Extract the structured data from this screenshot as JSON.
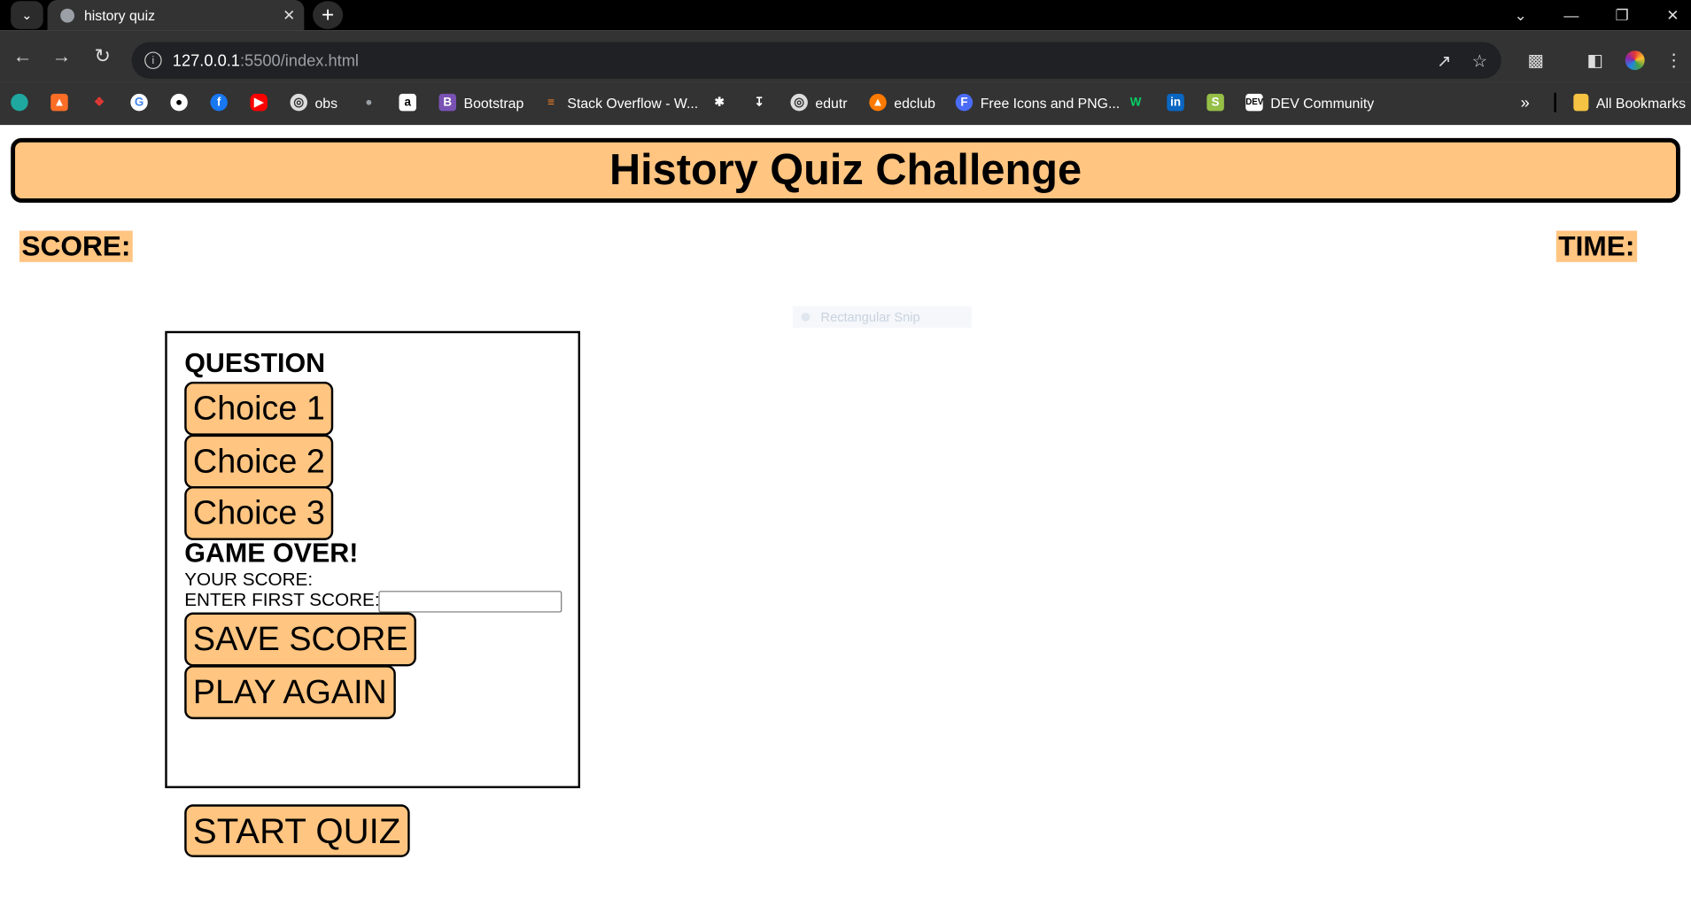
{
  "browser": {
    "tab_title": "history quiz",
    "url_host": "127.0.0.1",
    "url_path": ":5500/index.html",
    "bookmarks": [
      {
        "icon": "edge-icon",
        "label": "",
        "color": "#1fa8a0"
      },
      {
        "icon": "gitlab-icon",
        "label": "",
        "color": "#fc6d26"
      },
      {
        "icon": "codepen-icon",
        "label": "",
        "color": "#e53935"
      },
      {
        "icon": "google-icon",
        "label": "",
        "color": "#ffffff"
      },
      {
        "icon": "github-icon",
        "label": "",
        "color": "#ffffff"
      },
      {
        "icon": "facebook-icon",
        "label": "",
        "color": "#1877f2"
      },
      {
        "icon": "youtube-icon",
        "label": "",
        "color": "#ff0000"
      },
      {
        "icon": "globe-icon",
        "label": "obs",
        "color": "#dddddd"
      },
      {
        "icon": "apple-icon",
        "label": "",
        "color": "#9aa0a6"
      },
      {
        "icon": "amazon-icon",
        "label": "",
        "color": "#ffffff"
      },
      {
        "icon": "bootstrap-icon",
        "label": "Bootstrap",
        "color": "#7952b3"
      },
      {
        "icon": "stackoverflow-icon",
        "label": "Stack Overflow - W...",
        "color": "#f48024"
      },
      {
        "icon": "extension-icon",
        "label": "",
        "color": "#ffffff"
      },
      {
        "icon": "download-icon",
        "label": "",
        "color": "#ffffff"
      },
      {
        "icon": "globe-icon",
        "label": "edutr",
        "color": "#dddddd"
      },
      {
        "icon": "edclub-icon",
        "label": "edclub",
        "color": "#ff7a00"
      },
      {
        "icon": "flaticon-icon",
        "label": "Free Icons and PNG...",
        "color": "#4a6cf7"
      },
      {
        "icon": "wrike-icon",
        "label": "",
        "color": "#08cf65"
      },
      {
        "icon": "linkedin-icon",
        "label": "",
        "color": "#0a66c2"
      },
      {
        "icon": "shopify-icon",
        "label": "",
        "color": "#95bf47"
      },
      {
        "icon": "dev-icon",
        "label": "DEV Community",
        "color": "#ffffff"
      }
    ],
    "overflow_label": "»",
    "all_bookmarks_label": "All Bookmarks"
  },
  "page": {
    "title": "History Quiz Challenge",
    "score_label": "SCORE:",
    "time_label": "TIME:",
    "snip_overlay": "Rectangular Snip",
    "question": "QUESTION",
    "choices": [
      "Choice 1",
      "Choice 2",
      "Choice 3"
    ],
    "game_over": "GAME OVER!",
    "your_score": "YOUR SCORE:",
    "enter_score": "ENTER FIRST SCORE:",
    "save_score": "SAVE SCORE",
    "play_again": "PLAY AGAIN",
    "start_quiz": "START QUIZ",
    "accent_color": "#ffc581"
  }
}
